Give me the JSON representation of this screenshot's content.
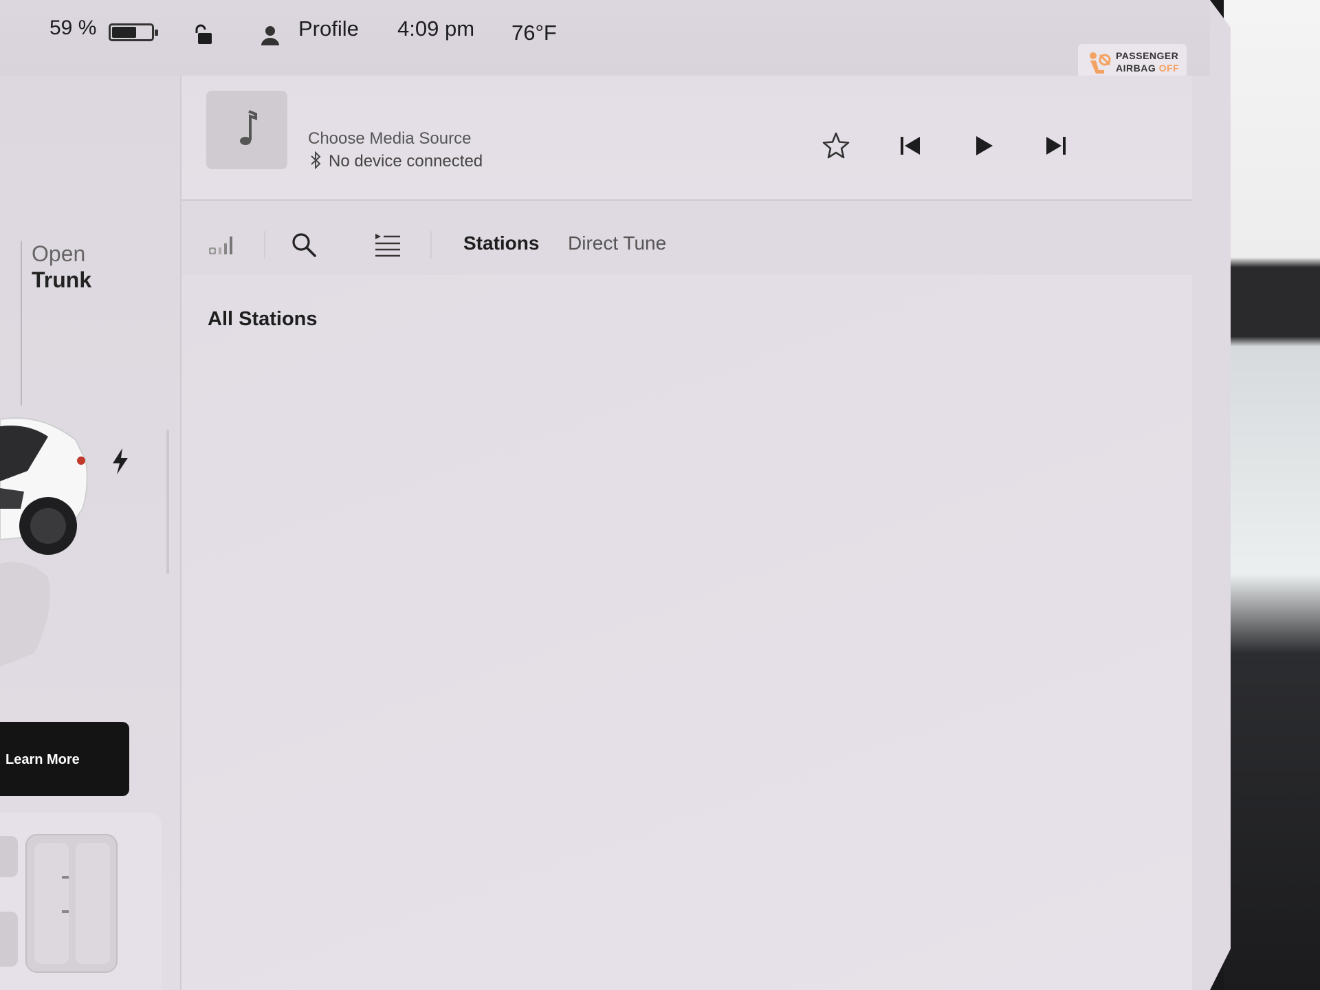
{
  "status_bar": {
    "battery_percent": "59 %",
    "battery_level": 0.59,
    "profile_label": "Profile",
    "time": "4:09 pm",
    "temperature": "76°F",
    "airbag": {
      "line1": "PASSENGER",
      "line2": "AIRBAG",
      "state": "OFF",
      "state_color": "#f4a261"
    }
  },
  "left_panel": {
    "trunk_action_prefix": "Open",
    "trunk_action": "Trunk",
    "learn_more_label": "Learn More"
  },
  "media": {
    "source_title": "Choose Media Source",
    "device_status": "No device connected",
    "controls": {
      "favorite_icon": "star-icon",
      "previous_icon": "skip-previous-icon",
      "play_icon": "play-icon",
      "next_icon": "skip-next-icon"
    }
  },
  "toolbar": {
    "icons": [
      "equalizer-icon",
      "search-icon",
      "queue-icon"
    ],
    "tabs": [
      {
        "label": "Stations",
        "active": true
      },
      {
        "label": "Direct Tune",
        "active": false
      }
    ]
  },
  "content": {
    "section_title": "All Stations"
  }
}
